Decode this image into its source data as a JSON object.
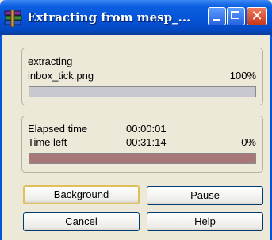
{
  "window": {
    "title": "Extracting from mesp_...",
    "colors": {
      "titlebar": "#0553d6",
      "close": "#d54a2a",
      "progress2": "#a87878"
    }
  },
  "file_group": {
    "status": "extracting",
    "filename": "inbox_tick.png",
    "percent": "100%",
    "progress": 1.0
  },
  "time_group": {
    "elapsed_label": "Elapsed time",
    "elapsed_value": "00:00:01",
    "left_label": "Time left",
    "left_value": "00:31:14",
    "percent": "0%",
    "progress": 0.0
  },
  "buttons": {
    "background": "Background",
    "pause": "Pause",
    "cancel": "Cancel",
    "help": "Help"
  },
  "icons": [
    "winrar-books-icon",
    "minimize-icon",
    "maximize-icon",
    "close-icon"
  ]
}
